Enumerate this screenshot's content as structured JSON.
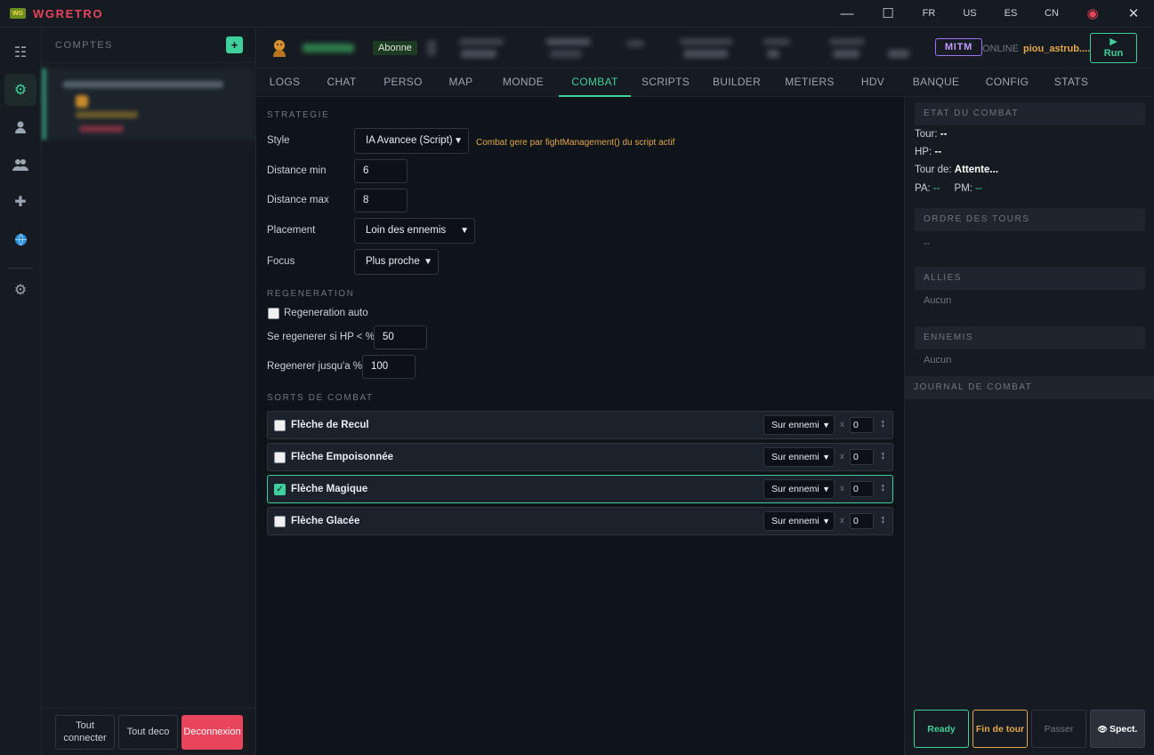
{
  "app": {
    "title": "WGRETRO",
    "logo_text": "WG"
  },
  "window": {
    "languages": [
      "FR",
      "US",
      "ES",
      "CN"
    ],
    "minimize_icon": "minimize-icon",
    "maximize_icon": "maximize-icon",
    "close_icon": "close-icon"
  },
  "rail": {
    "items": [
      {
        "name": "list-icon",
        "glyph": "☷"
      },
      {
        "name": "gear-icon",
        "glyph": "⚙"
      },
      {
        "name": "user-icon",
        "glyph": "👤"
      },
      {
        "name": "users-icon",
        "glyph": "👥"
      },
      {
        "name": "plus-icon",
        "glyph": "✚"
      },
      {
        "name": "globe-icon",
        "glyph": "◉"
      },
      {
        "name": "settings-icon",
        "glyph": "⚙"
      }
    ]
  },
  "accounts": {
    "title": "COMPTES",
    "add_label": "+",
    "footer": {
      "connect_all": "Tout connecter",
      "disconnect_all": "Tout deco",
      "logout": "Deconnexion"
    }
  },
  "header": {
    "badge": "Abonne",
    "mitm": "MITM",
    "online": "ONLINE",
    "username": "piou_astrub....",
    "run_icon": "▶",
    "run_label": "Run"
  },
  "tabs": [
    "LOGS",
    "CHAT",
    "PERSO",
    "MAP",
    "MONDE",
    "COMBAT",
    "SCRIPTS",
    "BUILDER",
    "METIERS",
    "HDV",
    "BANQUE",
    "CONFIG",
    "STATS"
  ],
  "active_tab": "COMBAT",
  "strategy": {
    "section": "STRATEGIE",
    "style_label": "Style",
    "style_value": "IA Avancee (Script)",
    "style_hint": "Combat gere par fightManagement() du script actif",
    "dist_min_label": "Distance min",
    "dist_min_value": "6",
    "dist_max_label": "Distance max",
    "dist_max_value": "8",
    "placement_label": "Placement",
    "placement_value": "Loin des ennemis",
    "focus_label": "Focus",
    "focus_value": "Plus proche"
  },
  "regen": {
    "section": "REGENERATION",
    "auto_label": "Regeneration auto",
    "auto_checked": false,
    "hp_below_label": "Se regenerer si HP < %",
    "hp_below_value": "50",
    "until_label": "Regenerer jusqu'a %",
    "until_value": "100"
  },
  "spells": {
    "section": "SORTS DE COMBAT",
    "items": [
      {
        "name": "Flèche de Recul",
        "checked": false,
        "target": "Sur ennemi",
        "x": "x",
        "count": "0"
      },
      {
        "name": "Flèche Empoisonnée",
        "checked": false,
        "target": "Sur ennemi",
        "x": "x",
        "count": "0"
      },
      {
        "name": "Flèche Magique",
        "checked": true,
        "target": "Sur ennemi",
        "x": "x",
        "count": "0"
      },
      {
        "name": "Flèche Glacée",
        "checked": false,
        "target": "Sur ennemi",
        "x": "x",
        "count": "0"
      }
    ]
  },
  "combat_state": {
    "section": "ETAT DU COMBAT",
    "tour_label": "Tour:",
    "tour_value": "--",
    "hp_label": "HP:",
    "hp_value": "--",
    "turn_of_label": "Tour de:",
    "turn_of_value": "Attente...",
    "pa_label": "PA:",
    "pa_value": "--",
    "pm_label": "PM:",
    "pm_value": "--",
    "order_section": "ORDRE DES TOURS",
    "order_value": "--",
    "allies_section": "ALLIES",
    "allies_value": "Aucun",
    "enemies_section": "ENNEMIS",
    "enemies_value": "Aucun",
    "journal_section": "JOURNAL DE COMBAT"
  },
  "actions": {
    "ready": "Ready",
    "end_turn": "Fin de tour",
    "pass": "Passer",
    "spectate_icon": "👁",
    "spectate": "Spect."
  }
}
